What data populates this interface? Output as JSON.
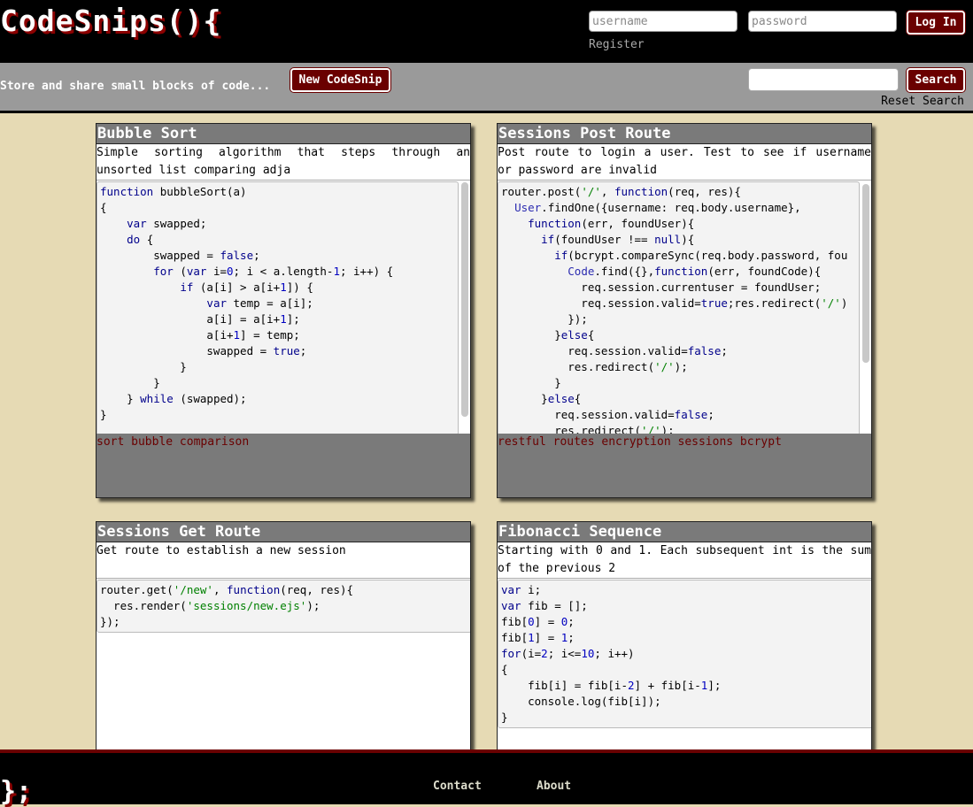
{
  "header": {
    "logo": "CodeSnips(){",
    "username_placeholder": "username",
    "password_placeholder": "password",
    "login_label": "Log In",
    "register_label": "Register"
  },
  "toolbar": {
    "tagline": "Store and share small blocks of code...",
    "new_label": "New CodeSnip",
    "search_value": "",
    "search_label": "Search",
    "reset_label": "Reset Search"
  },
  "snips": [
    {
      "title": "Bubble Sort",
      "description": "Simple sorting algorithm that steps through an unsorted list comparing adja",
      "tags": "sort bubble comparison"
    },
    {
      "title": "Sessions Post Route",
      "description": "Post route to login a user. Test to see if username or password are invalid",
      "tags": "restful routes encryption sessions bcrypt"
    },
    {
      "title": "Sessions Get Route",
      "description": "Get route to establish a new session",
      "tags": ""
    },
    {
      "title": "Fibonacci Sequence",
      "description": "Starting with 0 and 1. Each subsequent int is the sum of the previous 2",
      "tags": ""
    }
  ],
  "footer": {
    "closing": "};",
    "contact_label": "Contact",
    "about_label": "About"
  },
  "colors": {
    "background": "#e6dab4",
    "accent": "#6a0000",
    "card_header": "#7a7a7a",
    "toolbar": "#9a9a9a"
  }
}
